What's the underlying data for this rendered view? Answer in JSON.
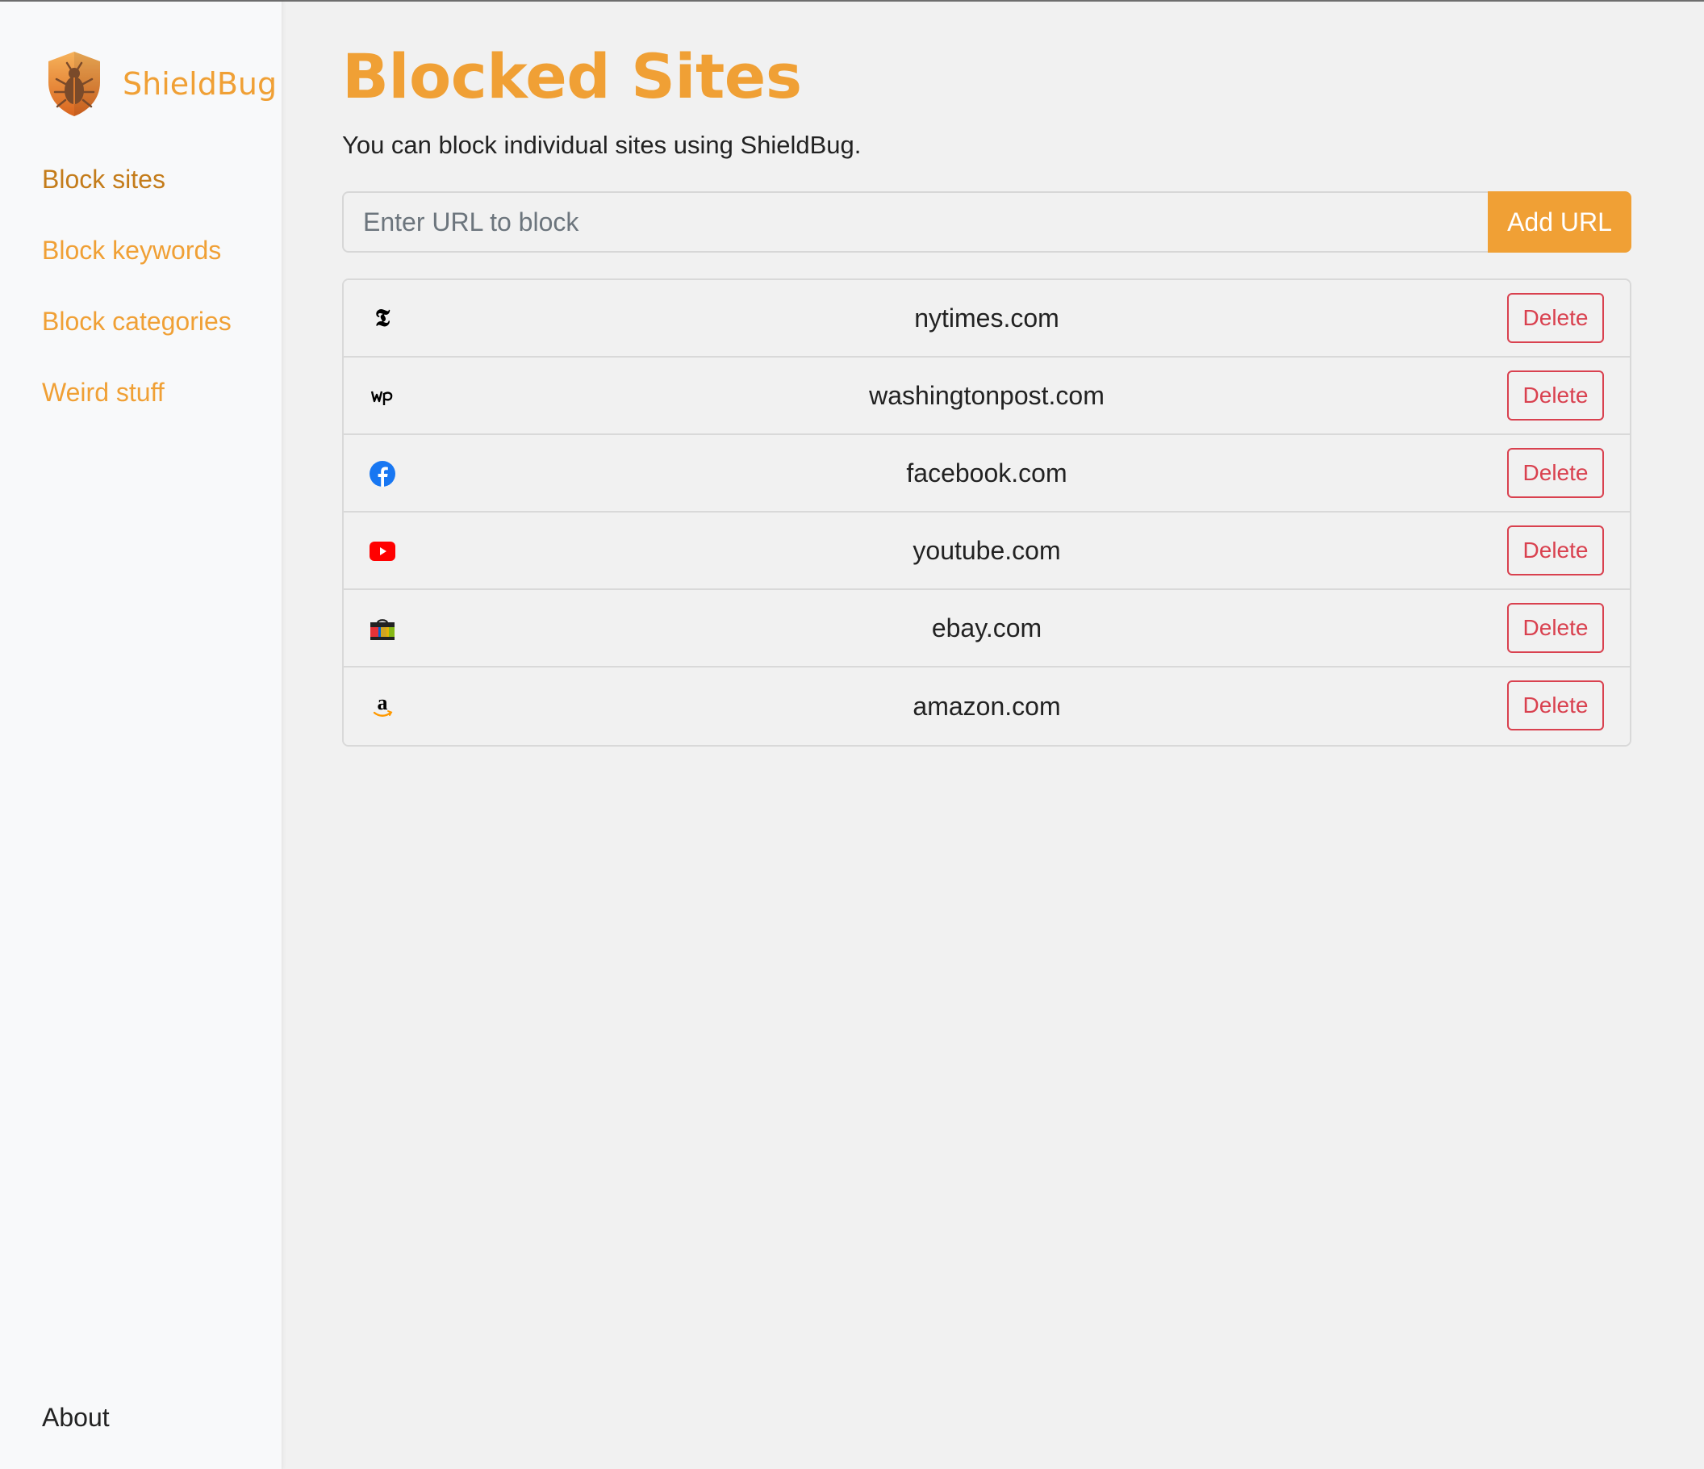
{
  "app": {
    "name": "ShieldBug",
    "brand_color": "#f0a035",
    "logo_icon": "shield-bug-logo"
  },
  "sidebar": {
    "items": [
      {
        "label": "Block sites",
        "active": true
      },
      {
        "label": "Block keywords",
        "active": false
      },
      {
        "label": "Block categories",
        "active": false
      },
      {
        "label": "Weird stuff",
        "active": false
      }
    ],
    "about_label": "About"
  },
  "main": {
    "title": "Blocked Sites",
    "subtitle": "You can block individual sites using ShieldBug.",
    "url_input": {
      "placeholder": "Enter URL to block",
      "value": ""
    },
    "add_button_label": "Add URL",
    "delete_label": "Delete",
    "sites": [
      {
        "domain": "nytimes.com",
        "icon": "nytimes-favicon"
      },
      {
        "domain": "washingtonpost.com",
        "icon": "washingtonpost-favicon"
      },
      {
        "domain": "facebook.com",
        "icon": "facebook-favicon"
      },
      {
        "domain": "youtube.com",
        "icon": "youtube-favicon"
      },
      {
        "domain": "ebay.com",
        "icon": "ebay-favicon"
      },
      {
        "domain": "amazon.com",
        "icon": "amazon-favicon"
      }
    ]
  },
  "colors": {
    "accent": "#f0a035",
    "active_nav": "#c47c1a",
    "delete": "#d9414f",
    "facebook": "#1877f2",
    "youtube": "#ff0000"
  }
}
